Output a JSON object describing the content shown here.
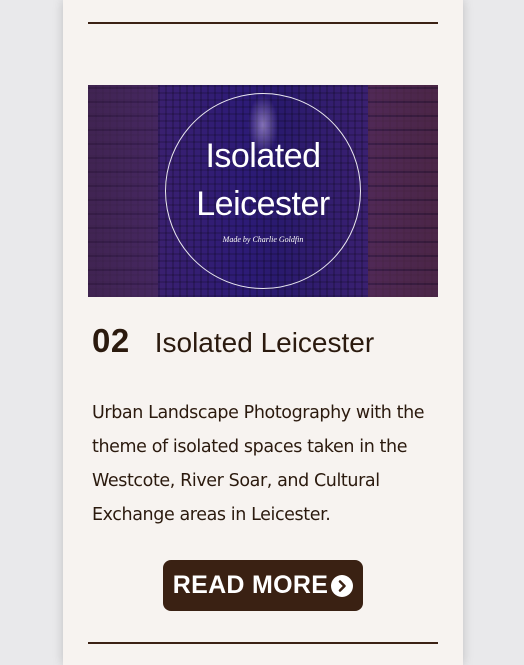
{
  "project": {
    "number": "02",
    "title": "Isolated Leicester",
    "description": "Urban Landscape Photography with the theme of isolated spaces taken in the Westcote, River Soar, and Cultural Exchange areas in Leicester.",
    "image": {
      "logo_line1": "Isolated",
      "logo_line2": "Leicester",
      "byline": "Made by Charlie Goldfin"
    },
    "button_label": "READ MORE",
    "button_icon": "chevron-right-circle-icon"
  },
  "colors": {
    "card_background": "#f7f3f0",
    "page_background": "#e9e9eb",
    "text": "#2b1a0e",
    "button_background": "#3a2113",
    "rule": "#3b2114"
  }
}
